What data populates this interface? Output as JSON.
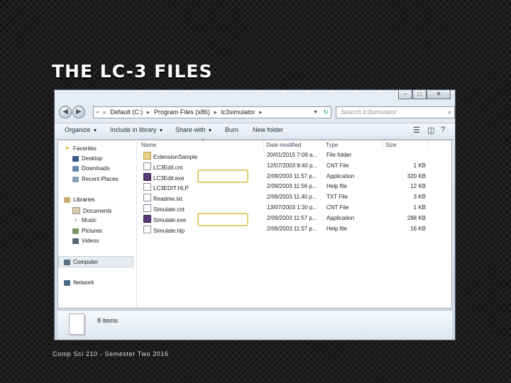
{
  "slide": {
    "title": "THE LC-3 FILES",
    "footer": "Comp Sci 210 - Semester Two 2016"
  },
  "window": {
    "controls": {
      "minimize": "–",
      "maximize": "□",
      "close": "✕"
    },
    "address_segments": [
      "Default (C:)",
      "Program Files (x86)",
      "lc3simulator"
    ],
    "search_placeholder": "Search lc3simulator",
    "toolbar": {
      "organize": "Organize",
      "include_in_library": "Include in library",
      "share_with": "Share with",
      "burn": "Burn",
      "new_folder": "New folder"
    },
    "nav": {
      "favorites": "Favorites",
      "desktop": "Desktop",
      "downloads": "Downloads",
      "recent_places": "Recent Places",
      "libraries": "Libraries",
      "documents": "Documents",
      "music": "Music",
      "pictures": "Pictures",
      "videos": "Videos",
      "computer": "Computer",
      "network": "Network"
    },
    "columns": {
      "name": "Name",
      "date_modified": "Date modified",
      "type": "Type",
      "size": "Size"
    },
    "files": [
      {
        "name": "ExtensionSample",
        "date": "20/01/2015 7:09 a...",
        "type": "File folder",
        "size": "",
        "icon": "folder-icon"
      },
      {
        "name": "LC3Edit.cnt",
        "date": "12/07/2003 8:40 p...",
        "type": "CNT File",
        "size": "1 KB",
        "icon": "document-icon"
      },
      {
        "name": "LC3Edit.exe",
        "date": "2/09/2003 11:57 p...",
        "type": "Application",
        "size": "320 KB",
        "icon": "application-icon"
      },
      {
        "name": "LC3EDIT.HLP",
        "date": "2/09/2003 11:56 p...",
        "type": "Help file",
        "size": "12 KB",
        "icon": "help-file-icon"
      },
      {
        "name": "Readme.txt",
        "date": "2/09/2003 11:40 p...",
        "type": "TXT File",
        "size": "3 KB",
        "icon": "document-icon"
      },
      {
        "name": "Simulate.cnt",
        "date": "13/07/2003 1:30 p...",
        "type": "CNT File",
        "size": "1 KB",
        "icon": "document-icon"
      },
      {
        "name": "Simulate.exe",
        "date": "2/09/2003 11:57 p...",
        "type": "Application",
        "size": "288 KB",
        "icon": "application-icon"
      },
      {
        "name": "Simulate.hlp",
        "date": "2/09/2003 11:57 p...",
        "type": "Help file",
        "size": "16 KB",
        "icon": "help-file-icon"
      }
    ],
    "status": {
      "items_count": "8 items"
    },
    "colors": {
      "highlight": "#e2cc6c",
      "background": "#1c1c1c"
    }
  }
}
